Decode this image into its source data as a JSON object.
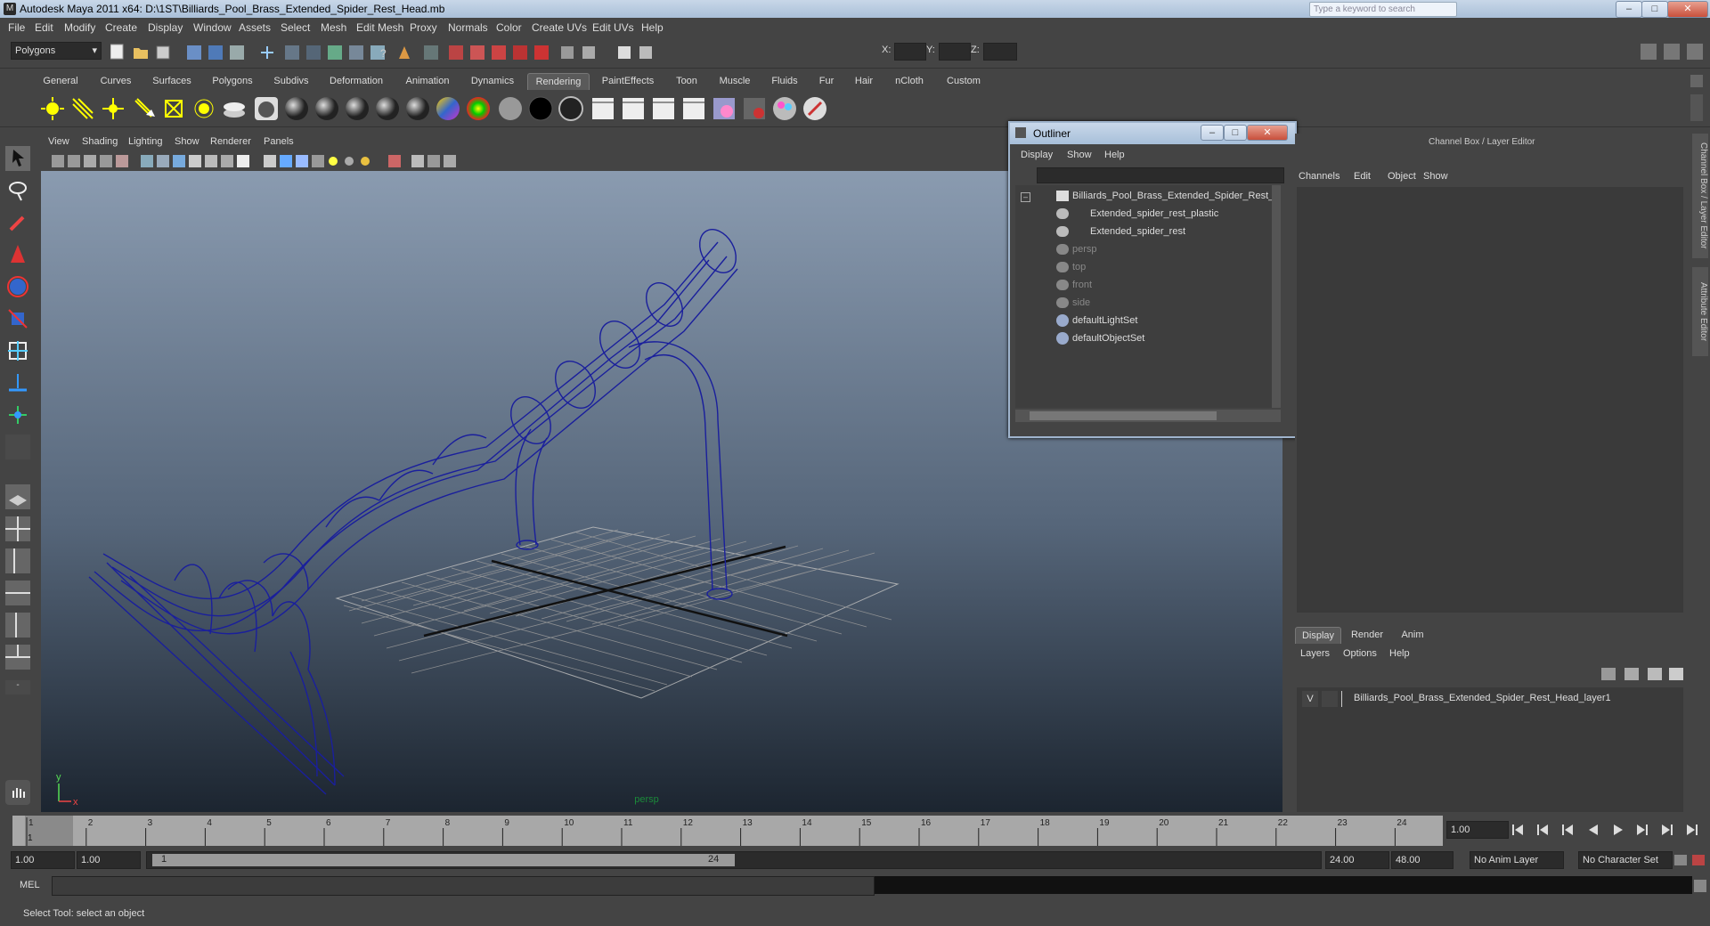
{
  "window": {
    "title": "Autodesk Maya 2011 x64: D:\\1ST\\Billiards_Pool_Brass_Extended_Spider_Rest_Head.mb",
    "search_placeholder": "Type a keyword to search"
  },
  "menubar": [
    "File",
    "Edit",
    "Modify",
    "Create",
    "Display",
    "Window",
    "Assets",
    "Select",
    "Mesh",
    "Edit Mesh",
    "Proxy",
    "Normals",
    "Color",
    "Create UVs",
    "Edit UVs",
    "Help"
  ],
  "statusline": {
    "mode": "Polygons",
    "x_label": "X:",
    "y_label": "Y:",
    "z_label": "Z:"
  },
  "shelf_tabs": [
    "General",
    "Curves",
    "Surfaces",
    "Polygons",
    "Subdivs",
    "Deformation",
    "Animation",
    "Dynamics",
    "Rendering",
    "PaintEffects",
    "Toon",
    "Muscle",
    "Fluids",
    "Fur",
    "Hair",
    "nCloth",
    "Custom"
  ],
  "active_shelf_tab": "Rendering",
  "viewport": {
    "menu": [
      "View",
      "Shading",
      "Lighting",
      "Show",
      "Renderer",
      "Panels"
    ],
    "camera_label": "persp",
    "axis_x": "x",
    "axis_y": "y"
  },
  "outliner": {
    "title": "Outliner",
    "menu": [
      "Display",
      "Show",
      "Help"
    ],
    "items": [
      {
        "label": "Billiards_Pool_Brass_Extended_Spider_Rest_",
        "dim": false
      },
      {
        "label": "Extended_spider_rest_plastic",
        "dim": false
      },
      {
        "label": "Extended_spider_rest",
        "dim": false
      },
      {
        "label": "persp",
        "dim": true
      },
      {
        "label": "top",
        "dim": true
      },
      {
        "label": "front",
        "dim": true
      },
      {
        "label": "side",
        "dim": true
      },
      {
        "label": "defaultLightSet",
        "dim": false
      },
      {
        "label": "defaultObjectSet",
        "dim": false
      }
    ]
  },
  "channel_box": {
    "title": "Channel Box / Layer Editor",
    "menu": [
      "Channels",
      "Edit",
      "Object",
      "Show"
    ],
    "side_tab_1": "Channel Box / Layer Editor",
    "side_tab_2": "Attribute Editor"
  },
  "layer_editor": {
    "tabs": [
      "Display",
      "Render",
      "Anim"
    ],
    "menu": [
      "Layers",
      "Options",
      "Help"
    ],
    "layer_visibility": "V",
    "layer_name": "Billiards_Pool_Brass_Extended_Spider_Rest_Head_layer1"
  },
  "time_slider": {
    "ticks": [
      "1",
      "2",
      "3",
      "4",
      "5",
      "6",
      "7",
      "8",
      "9",
      "10",
      "11",
      "12",
      "13",
      "14",
      "15",
      "16",
      "17",
      "18",
      "19",
      "20",
      "21",
      "22",
      "23",
      "24"
    ],
    "current_frame_marker": "1",
    "current_frame_field": "1.00"
  },
  "range_slider": {
    "start_time": "1.00",
    "playback_start": "1.00",
    "range_start_label": "1",
    "range_end_label": "24",
    "playback_end": "24.00",
    "end_time": "48.00",
    "anim_layer": "No Anim Layer",
    "character_set": "No Character Set"
  },
  "command_line": {
    "label": "MEL"
  },
  "help_line": {
    "text": "Select Tool: select an object"
  }
}
